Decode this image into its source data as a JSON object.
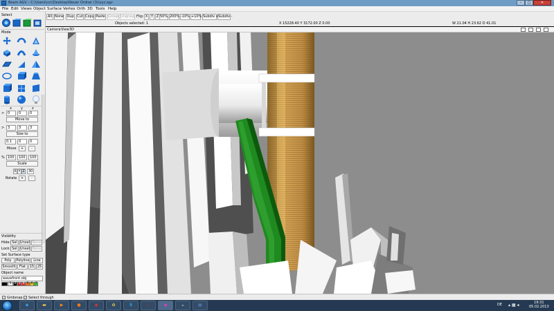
{
  "window": {
    "title": "Beam AGV – C:\\Users\\ccc\\Desktop\\Neuer Ordner (3)\\xyz.agv"
  },
  "menubar": [
    "File",
    "Edit",
    "Views",
    "Object",
    "Surface",
    "Vertex",
    "Orth",
    "3D",
    "Tools",
    "Help"
  ],
  "toolbar": {
    "buttons": [
      "All",
      "None",
      "Dup",
      "Cut",
      "Copy",
      "Paste"
    ],
    "group": "Group",
    "ungroup": "Ungroup",
    "flip_label": "Flip:",
    "flip": [
      "X",
      "Y",
      "Z"
    ],
    "zoom": [
      "50%",
      "200%",
      "-10%",
      "+10%"
    ],
    "subdiv_plus": "Subdiv +",
    "subdiv_minus": "Subdiv -"
  },
  "status": {
    "selected": "Objects selected: 1",
    "coords": "X 15228.40 Y 3172.00 Z 0.00",
    "dims": "W 21.04 H 23.62 D 41.01"
  },
  "viewmenu": [
    "Camera",
    "View",
    "3D"
  ],
  "panel": {
    "select_label": "Select",
    "mode_label": "Mode",
    "axes": [
      "x",
      "y",
      "z"
    ],
    "move_values": [
      "0",
      "0",
      "0"
    ],
    "move_button": "Move to",
    "size_values": [
      "3",
      "3",
      "3"
    ],
    "size_button": "Size to",
    "step_values": [
      "0.1",
      "0",
      "0"
    ],
    "move_step": "Move",
    "pct_label": "%",
    "scale_values": [
      "100",
      "100",
      "100"
    ],
    "scale_button": "Scale",
    "rot_axes": [
      "X",
      "Y",
      "Z"
    ],
    "rot_value": "30",
    "rotate_label": "Rotate",
    "plus": "+",
    "minus": "-",
    "gt": ">",
    "visibility_label": "Visibility",
    "hide_label": "Hide:",
    "lock_label": "Lock:",
    "sel": "Sel",
    "unsel": "Unsel",
    "none": "None",
    "surface_type_label": "Set Surface type",
    "surface_types": [
      "Poly",
      "Polyline",
      "Line"
    ],
    "smooth": "Smooth",
    "flat": "Flat",
    "s15": "15",
    "s25": "25",
    "object_name_label": "Object name",
    "object_name": "wavefront.obj",
    "swatches": [
      {
        "label": "1",
        "color": "#ffffff"
      },
      {
        "label": "2",
        "color": "#000000"
      },
      {
        "label": "3",
        "color": "#cc1111"
      },
      {
        "label": "4",
        "color": "#ee2222"
      },
      {
        "label": "5",
        "color": "#ff7700"
      },
      {
        "label": "6",
        "color": "#ffcc00"
      },
      {
        "label": "7",
        "color": "#33cc33"
      }
    ]
  },
  "bottombar": {
    "gridsnap": "Gridsnap",
    "selectthrough": "Select through"
  },
  "taskbar": {
    "lang": "DE",
    "time": "19:31",
    "date": "05.02.2013",
    "apps": [
      "explorer",
      "media-player",
      "firefox",
      "chrome",
      "plugins",
      "skype",
      "opera",
      "image-viewer",
      "shape-app",
      "doc-app"
    ]
  }
}
